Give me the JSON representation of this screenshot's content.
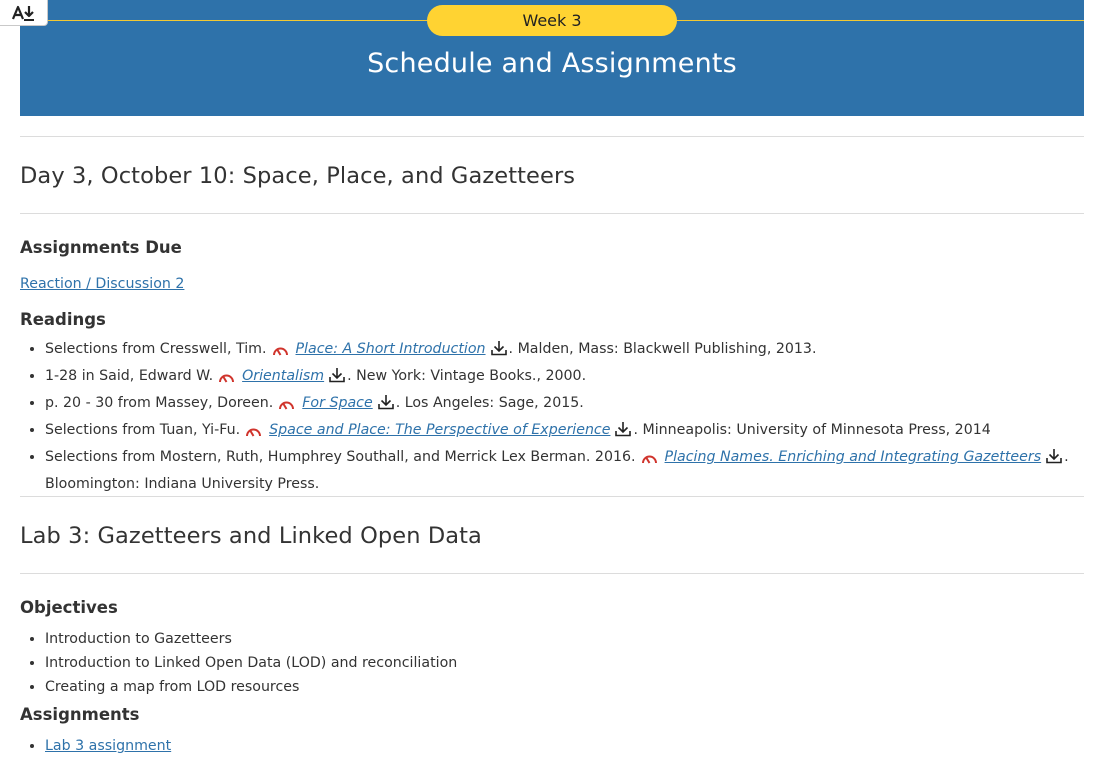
{
  "header": {
    "week_label": "Week 3",
    "title": "Schedule and Assignments"
  },
  "day": {
    "heading": "Day 3, October 10: Space, Place, and Gazetteers",
    "assignments_heading": "Assignments Due",
    "assignment_link": "Reaction / Discussion 2",
    "readings_heading": "Readings",
    "readings": [
      {
        "prefix": "Selections from Cresswell, Tim.",
        "title": "Place: A Short Introduction",
        "suffix": ". Malden, Mass: Blackwell Publishing, 2013."
      },
      {
        "prefix": "1-28 in Said, Edward W.",
        "title": "Orientalism",
        "suffix": ". New York: Vintage Books., 2000."
      },
      {
        "prefix": "p. 20 - 30 from Massey, Doreen.",
        "title": "For Space",
        "suffix": ". Los Angeles: Sage, 2015."
      },
      {
        "prefix": "Selections from Tuan, Yi-Fu.",
        "title": "Space and Place: The Perspective of Experience",
        "suffix": ". Minneapolis: University of Minnesota Press, 2014"
      },
      {
        "prefix": "Selections from Mostern, Ruth, Humphrey Southall, and Merrick Lex Berman. 2016.",
        "title": "Placing Names. Enriching and Integrating Gazetteers",
        "suffix": ". Bloomington: Indiana University Press."
      }
    ]
  },
  "lab": {
    "heading": "Lab 3: Gazetteers and Linked Open Data",
    "objectives_heading": "Objectives",
    "objectives": [
      "Introduction to Gazetteers",
      "Introduction to Linked Open Data (LOD) and reconciliation",
      "Creating a map from LOD resources"
    ],
    "assignments_heading": "Assignments",
    "assignment_link": "Lab 3 assignment"
  },
  "icons": {
    "accessibility": "text-size-download-icon",
    "difficulty": "gauge-icon",
    "download": "download-icon"
  },
  "colors": {
    "banner": "#2e72aa",
    "pill": "#ffd332",
    "link": "#2e72aa",
    "gauge": "#d0342c"
  }
}
